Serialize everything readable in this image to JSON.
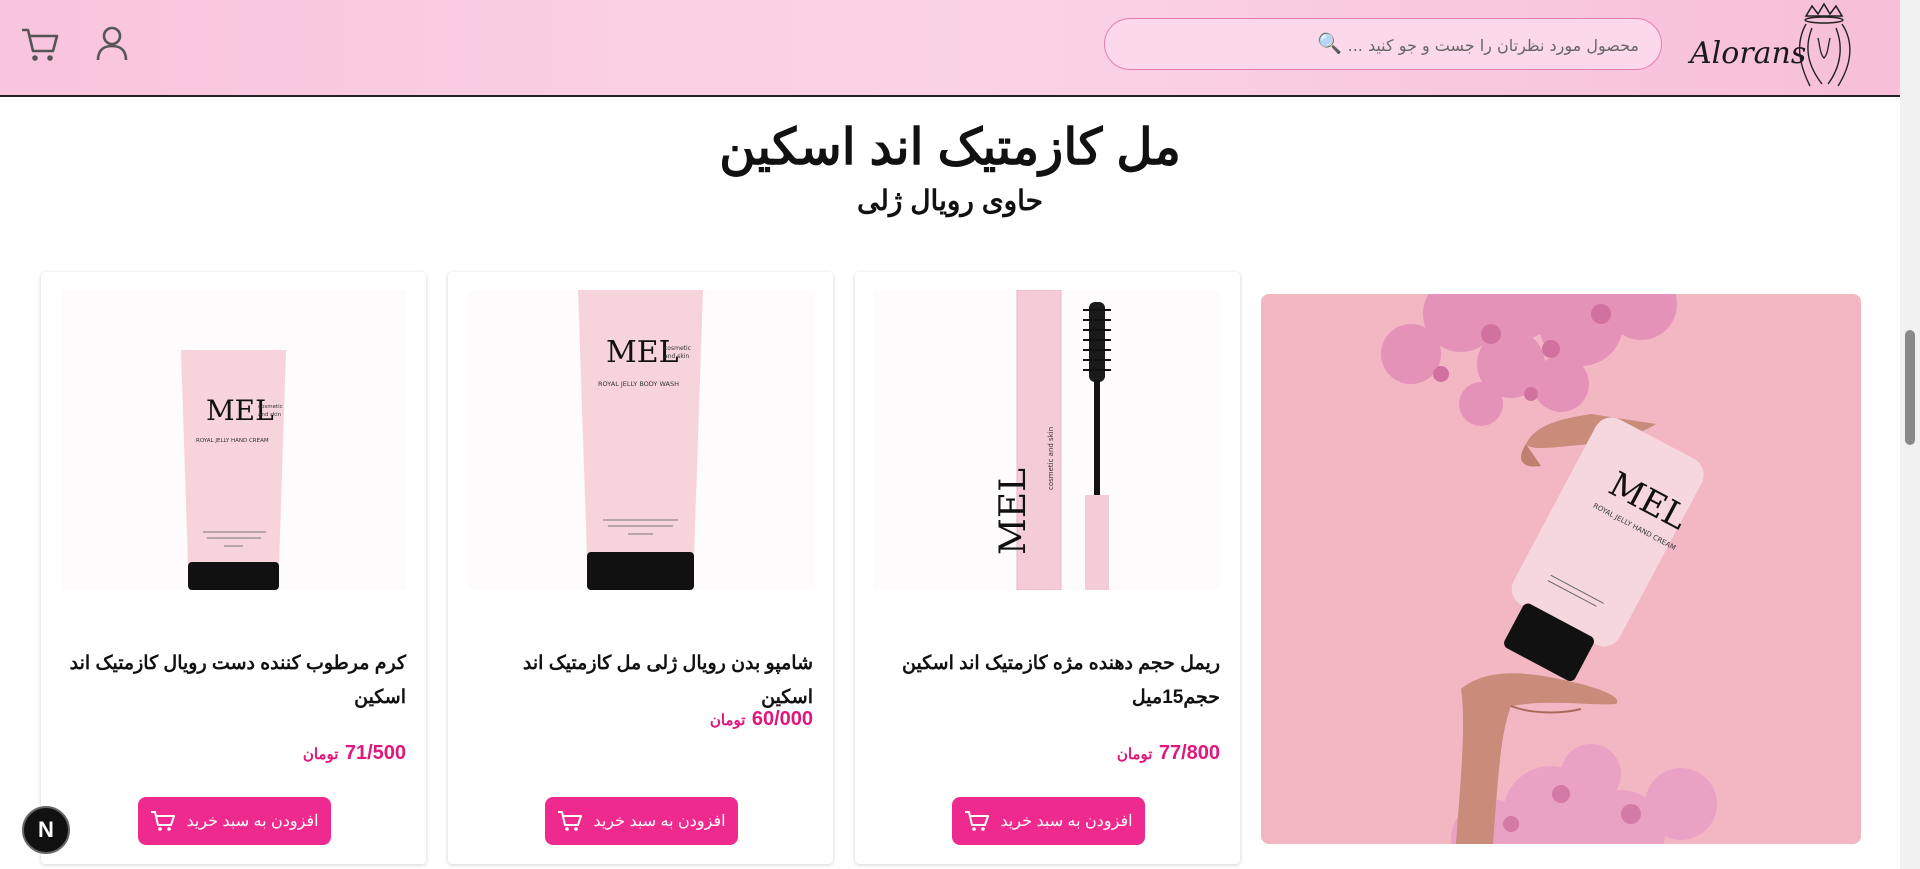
{
  "header": {
    "logo_text": "Alorans",
    "search": {
      "placeholder": "محصول مورد نظرتان را جست و جو کنید ..."
    },
    "icons": {
      "search": "search-icon",
      "user": "user-icon",
      "cart": "cart-icon"
    }
  },
  "section": {
    "title": "مل کازمتیک اند اسکین",
    "subtitle": "حاوی رویال ژلی"
  },
  "products": [
    {
      "name": "ریمل حجم دهنده مژه کازمتیک اند اسکین حجم15میل",
      "price": "77/800",
      "currency": "تومان",
      "button": "افزودن به سبد خرید",
      "image": "mascara"
    },
    {
      "name": "شامپو بدن رویال ژلی مل کازمتیک اند اسکین",
      "price": "60/000",
      "currency": "تومان",
      "button": "افزودن به سبد خرید",
      "image": "body-wash-tube"
    },
    {
      "name": "کرم مرطوب کننده دست رویال کازمتیک اند اسکین",
      "price": "71/500",
      "currency": "تومان",
      "button": "افزودن به سبد خرید",
      "image": "hand-cream-tube"
    }
  ],
  "product_image_text": {
    "brand": "MEL",
    "brand_sub": "cosmetic and skin",
    "body_wash_label": "ROYAL JELLY BODY WASH",
    "hand_cream_label": "ROYAL JELLY HAND CREAM"
  },
  "fab_label": "N",
  "colors": {
    "accent": "#ef2a8e",
    "price": "#e0177c",
    "header_bg": "#fbd3e6"
  }
}
